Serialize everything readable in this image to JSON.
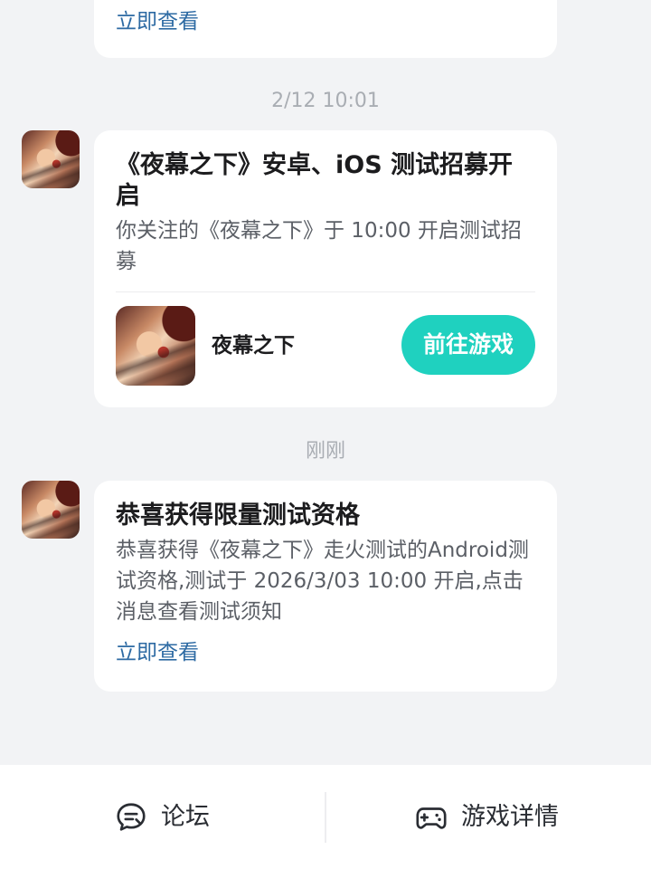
{
  "messages": [
    {
      "link_label": "立即查看"
    },
    {
      "time": "2/12  10:01",
      "title": "《夜幕之下》安卓、iOS 测试招募开启",
      "body": "你关注的《夜幕之下》于 10:00 开启测试招募",
      "game": {
        "name": "夜幕之下",
        "button_label": "前往游戏"
      }
    },
    {
      "time": "刚刚",
      "title": "恭喜获得限量测试资格",
      "body": "恭喜获得《夜幕之下》走火测试的Android测试资格,测试于 2026/3/03 10:00 开启,点击消息查看测试须知",
      "link_label": "立即查看"
    }
  ],
  "bottom_bar": {
    "forum": {
      "label": "论坛",
      "icon": "forum-chat-icon"
    },
    "game_detail": {
      "label": "游戏详情",
      "icon": "gamepad-icon"
    }
  },
  "colors": {
    "accent": "#1fd1bf",
    "link": "#2d6aa3",
    "background": "#f2f3f5"
  }
}
